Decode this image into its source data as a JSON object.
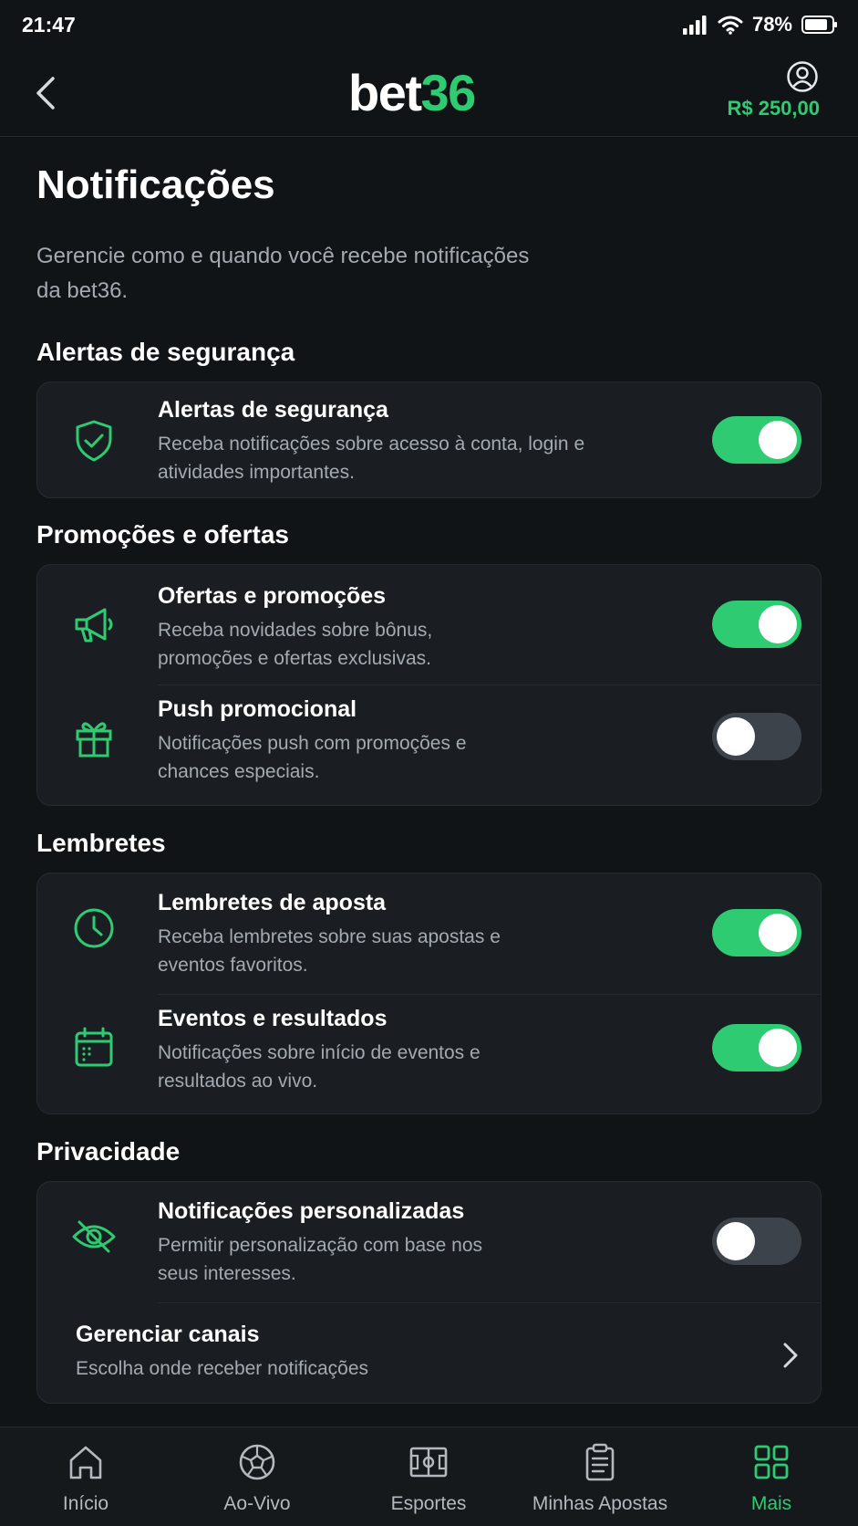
{
  "status_bar": {
    "time": "21:47",
    "battery": "78%"
  },
  "header": {
    "logo_white": "bet",
    "logo_green": "36",
    "balance": "R$ 250,00"
  },
  "page": {
    "title": "Notificações",
    "subtitle": "Gerencie como e quando você recebe notificações da bet36."
  },
  "sections": {
    "security": {
      "title": "Alertas de segurança",
      "items": [
        {
          "title": "Alertas de segurança",
          "desc": "Receba notificações sobre acesso à conta, login e atividades importantes.",
          "enabled": true
        }
      ]
    },
    "promotions": {
      "title": "Promoções e ofertas",
      "items": [
        {
          "title": "Ofertas e promoções",
          "desc": "Receba novidades sobre bônus, promoções e ofertas exclusivas.",
          "enabled": true
        },
        {
          "title": "Push promocional",
          "desc": "Notificações push com promoções e chances especiais.",
          "enabled": false
        }
      ]
    },
    "reminders": {
      "title": "Lembretes",
      "items": [
        {
          "title": "Lembretes de aposta",
          "desc": "Receba lembretes sobre suas apostas e eventos favoritos.",
          "enabled": true
        },
        {
          "title": "Eventos e resultados",
          "desc": "Notificações sobre início de eventos e resultados ao vivo.",
          "enabled": true
        }
      ]
    },
    "privacy": {
      "title": "Privacidade",
      "items": [
        {
          "title": "Notificações personalizadas",
          "desc": "Permitir personalização com base nos seus interesses.",
          "enabled": false
        }
      ],
      "manage": {
        "title": "Gerenciar canais",
        "desc": "Escolha onde receber notificações"
      }
    }
  },
  "bottom_nav": {
    "items": [
      {
        "label": "Início",
        "icon": "home-icon"
      },
      {
        "label": "Ao-Vivo",
        "icon": "soccer-ball-icon"
      },
      {
        "label": "Esportes",
        "icon": "field-icon"
      },
      {
        "label": "Minhas Apostas",
        "icon": "clipboard-icon"
      },
      {
        "label": "Mais",
        "icon": "grid-icon",
        "active": true
      }
    ]
  },
  "colors": {
    "accent": "#2ecb72",
    "background": "#111417",
    "card": "#1a1e22",
    "toggle_off": "#3d434a"
  }
}
